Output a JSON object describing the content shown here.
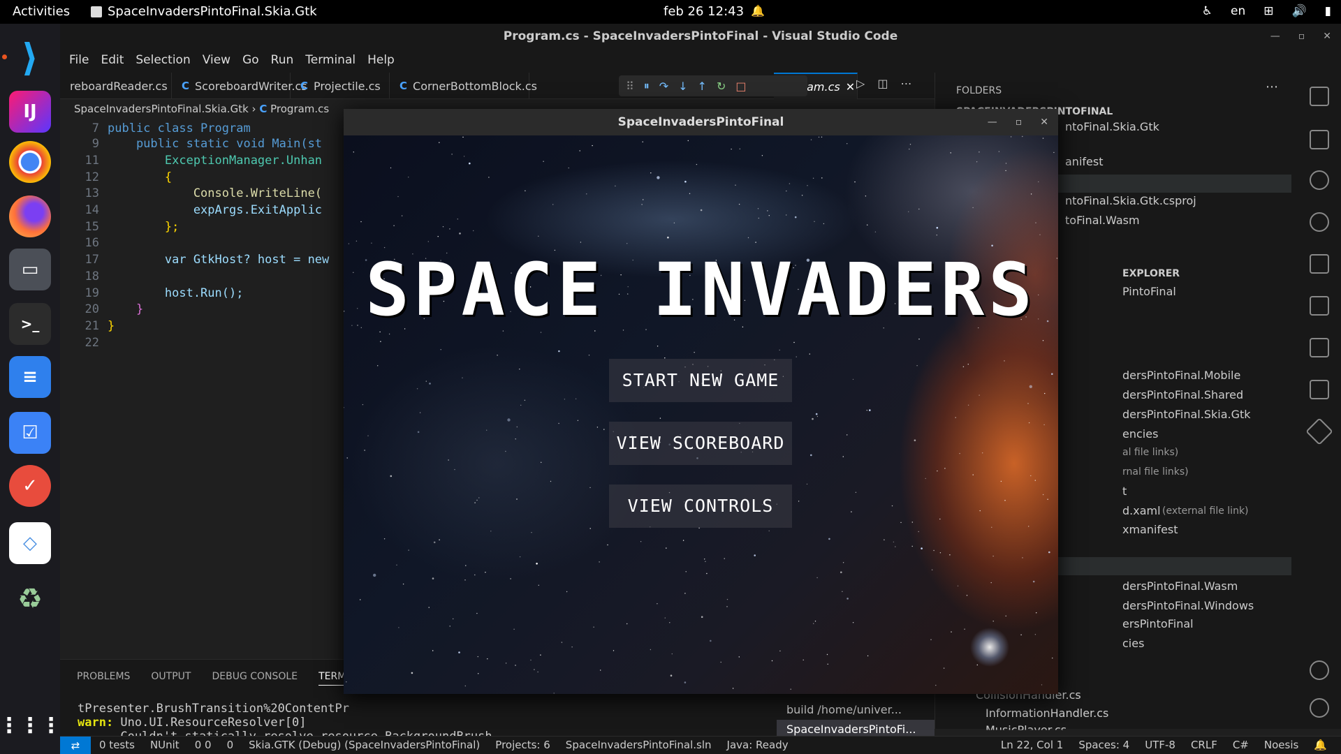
{
  "topbar": {
    "activities": "Activities",
    "app_name": "SpaceInvadersPintoFinal.Skia.Gtk",
    "clock": "feb 26  12:43",
    "lang": "en"
  },
  "window": {
    "title": "Program.cs - SpaceInvadersPintoFinal - Visual Studio Code"
  },
  "menu": [
    "File",
    "Edit",
    "Selection",
    "View",
    "Go",
    "Run",
    "Terminal",
    "Help"
  ],
  "tabs": [
    {
      "label": "reboardReader.cs"
    },
    {
      "label": "ScoreboardWriter.cs"
    },
    {
      "label": "Projectile.cs"
    },
    {
      "label": "CornerBottomBlock.cs"
    },
    {
      "label": "rogram.cs"
    }
  ],
  "breadcrumb": {
    "project": "SpaceInvadersPintoFinal.Skia.Gtk",
    "file": "Program.cs"
  },
  "code": {
    "lines": [
      {
        "n": "7",
        "t": "public class Program"
      },
      {
        "n": "9",
        "t": "    public static void Main(st"
      },
      {
        "n": "11",
        "t": "        ExceptionManager.Unhan"
      },
      {
        "n": "12",
        "t": "        {"
      },
      {
        "n": "13",
        "t": "            Console.WriteLine("
      },
      {
        "n": "14",
        "t": "            expArgs.ExitApplic"
      },
      {
        "n": "15",
        "t": "        };"
      },
      {
        "n": "16",
        "t": ""
      },
      {
        "n": "17",
        "t": "        var GtkHost? host = new"
      },
      {
        "n": "18",
        "t": ""
      },
      {
        "n": "19",
        "t": "        host.Run();"
      },
      {
        "n": "20",
        "t": "    }"
      },
      {
        "n": "21",
        "t": "}"
      },
      {
        "n": "22",
        "t": ""
      }
    ]
  },
  "panel": {
    "tabs": [
      "PROBLEMS",
      "OUTPUT",
      "DEBUG CONSOLE",
      "TERMINAL"
    ],
    "term_line1": "tPresenter.BrushTransition%20ContentPr",
    "term_warn": "warn:",
    "term_line2": " Uno.UI.ResourceResolver[0]",
    "term_line3": "      Couldn't statically resolve resource BackgroundBrush",
    "term_list": [
      "build /home/univer...",
      "SpaceInvadersPintoFi..."
    ]
  },
  "sidebar": {
    "folders_label": "FOLDERS",
    "items": [
      "SPACEINVADERSPINTOFINAL",
      "ntoFinal.Skia.Gtk",
      "anifest",
      "ntoFinal.Skia.Gtk.csproj",
      "toFinal.Wasm",
      "EXPLORER",
      "PintoFinal",
      "dersPintoFinal.Mobile",
      "dersPintoFinal.Shared",
      "dersPintoFinal.Skia.Gtk",
      "encies",
      "al file links)",
      "rnal file links)",
      "t",
      "d.xaml",
      "(external file link)",
      "xmanifest",
      "dersPintoFinal.Wasm",
      "dersPintoFinal.Windows",
      "ersPintoFinal",
      "cies",
      "CollisionHandler.cs",
      "InformationHandler.cs",
      "MusicPlayer.cs"
    ]
  },
  "status": {
    "tests": "0 tests",
    "nunit": "NUnit",
    "problems": "0  0",
    "ports": "0",
    "debug": "Skia.GTK (Debug) (SpaceInvadersPintoFinal)",
    "projects": "Projects: 6",
    "sln": "SpaceInvadersPintoFinal.sln",
    "java": "Java: Ready",
    "pos": "Ln 22, Col 1",
    "spaces": "Spaces: 4",
    "enc": "UTF-8",
    "eol": "CRLF",
    "lang": "C#",
    "user": "Noesis"
  },
  "game": {
    "window_title": "SpaceInvadersPintoFinal",
    "title": "SPACE INVADERS",
    "btn_start": "START NEW GAME",
    "btn_scoreboard": "VIEW SCOREBOARD",
    "btn_controls": "VIEW CONTROLS"
  },
  "colors": {
    "accent": "#0078d4",
    "editor_bg": "#1f1f1f",
    "keyword": "#569cd6",
    "type": "#4ec9b0"
  }
}
